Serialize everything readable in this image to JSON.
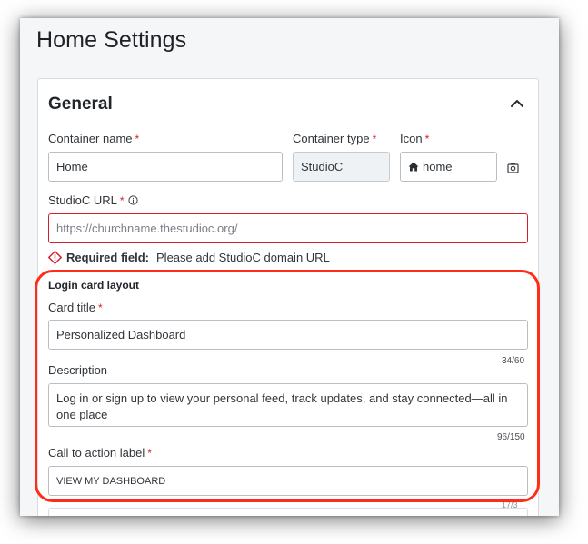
{
  "page": {
    "title": "Home Settings"
  },
  "section": {
    "title": "General"
  },
  "fields": {
    "container_name": {
      "label": "Container name",
      "required_mark": "*",
      "value": "Home"
    },
    "container_type": {
      "label": "Container type",
      "required_mark": "*",
      "value": "StudioC"
    },
    "icon": {
      "label": "Icon",
      "required_mark": "*",
      "value": "home"
    },
    "studioc_url": {
      "label": "StudioC URL",
      "required_mark": "*",
      "placeholder": "https://churchname.thestudioc.org/",
      "error_title": "Required field:",
      "error_message": "Please add StudioC domain URL"
    }
  },
  "login_card": {
    "heading": "Login card layout",
    "card_title": {
      "label": "Card title",
      "required_mark": "*",
      "value": "Personalized Dashboard",
      "counter": "34/60"
    },
    "description": {
      "label": "Description",
      "value": "Log in or sign up to view your personal feed, track updates, and stay connected—all in one place",
      "counter": "96/150"
    },
    "cta": {
      "label": "Call to action label",
      "required_mark": "*",
      "value": "VIEW MY DASHBOARD",
      "counter": "17/3"
    }
  },
  "colors": {
    "required": "#d4202b",
    "highlight": "#ff2d17",
    "error_border": "#d4202b"
  },
  "icons": [
    "chevron-up-icon",
    "home-icon",
    "image-picker-icon",
    "info-icon",
    "warning-diamond-icon"
  ]
}
